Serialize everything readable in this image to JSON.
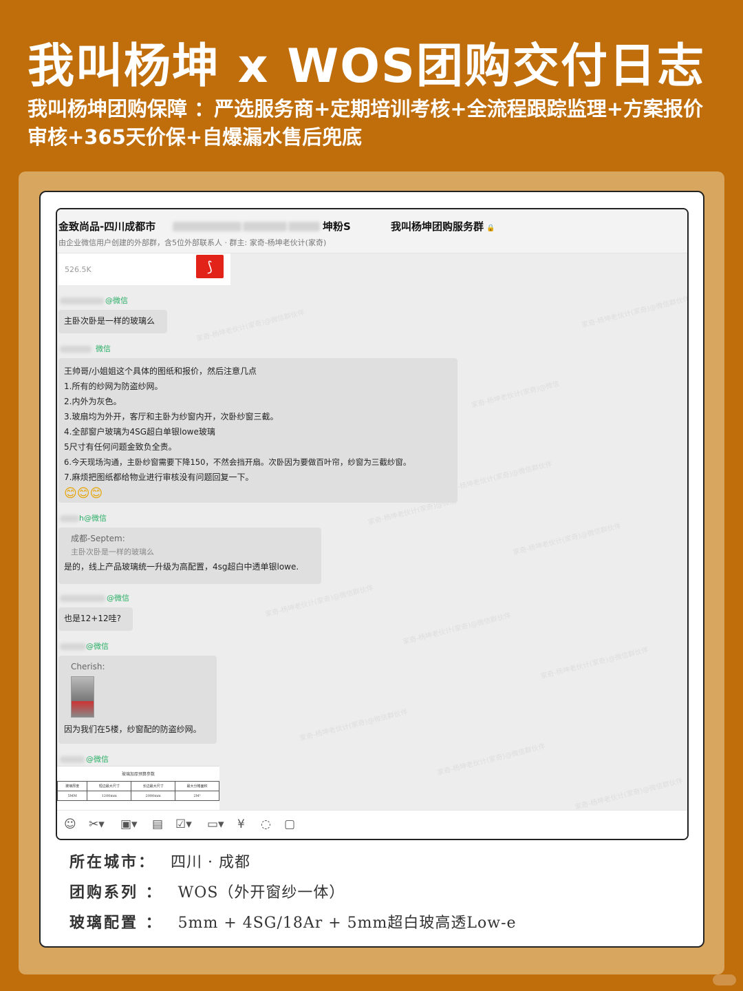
{
  "title": "我叫杨坤 x WOS团购交付日志",
  "subtitle": "我叫杨坤团购保障 ：严选服务商+定期培训考核+全流程跟踪监理+方案报价审核+365天价保+自爆漏水售后兜底",
  "chat": {
    "header_title": "金致尚品-四川成都市",
    "header_mid": "坤粉S",
    "header_group": "我叫杨坤团购服务群",
    "header_sub": "由企业微信用户创建的外部群，含5位外部联系人 · 群主: 家奇-杨坤老伙计(家奇)",
    "file_size": "526.5K",
    "sender_tag_1": "@微信",
    "msg_1": "主卧次卧是一样的玻璃么",
    "sender_tag_2": "微信",
    "msg_2_lines": [
      "王帅哥/小姐姐这个具体的图纸和报价，然后注意几点",
      "1.所有的纱网为防盗纱网。",
      "2.内外为灰色。",
      "3.玻扇均为外开，客厅和主卧为纱窗内开，次卧纱窗三截。",
      "4.全部窗户玻璃为4SG超白单银lowe玻璃",
      "5尺寸有任何问题金致负全责。",
      "6.今天现场沟通，主卧纱窗需要下降150，不然会挡开扇。次卧因为要做百叶帘，纱窗为三截纱窗。",
      "7.麻烦把图纸都给物业进行审核没有问题回复一下。"
    ],
    "msg_2_emoji": "😊😊😊",
    "sender_tag_3": "h@微信",
    "quote_name": "成都-Septem:",
    "quote_text": "主卧次卧是一样的玻璃么",
    "msg_3": "是的，线上产品玻璃统一升级为高配置，4sg超白中透单银lowe.",
    "sender_tag_4": "@微信",
    "msg_4": "也是12+12哇?",
    "sender_tag_5": "@微信",
    "quote_name_2": "Cherish:",
    "msg_5": "因为我们在5楼，纱窗配的防盗纱网。",
    "sender_tag_6": "@微信",
    "table_caption": "玻璃加厚预算参数",
    "table_headers": [
      "玻璃厚度",
      "短边最大尺寸",
      "长边最大尺寸",
      "最大分格面积"
    ],
    "table_row": [
      "5MM",
      "1200mm",
      "2000mm",
      "2M²"
    ],
    "toolbar_icons": [
      "emoji-icon",
      "scissors-icon",
      "image-icon",
      "document-icon",
      "checkbox-icon",
      "folder-icon",
      "yuan-icon",
      "chat-icon",
      "screen-share-icon"
    ]
  },
  "info": {
    "city_label": "所在城市：",
    "city_value": "四川 · 成都",
    "series_label": "团购系列 ：",
    "series_value": "WOS（外开窗纱一体）",
    "glass_label": "玻璃配置 ：",
    "glass_value": "5mm + 4SG/18Ar + 5mm超白玻高透Low-e"
  },
  "colors": {
    "background": "#BF6E0B",
    "panel": "#D9A660",
    "wechat_green": "#2BAE66",
    "bubble": "#DFDFDF"
  }
}
